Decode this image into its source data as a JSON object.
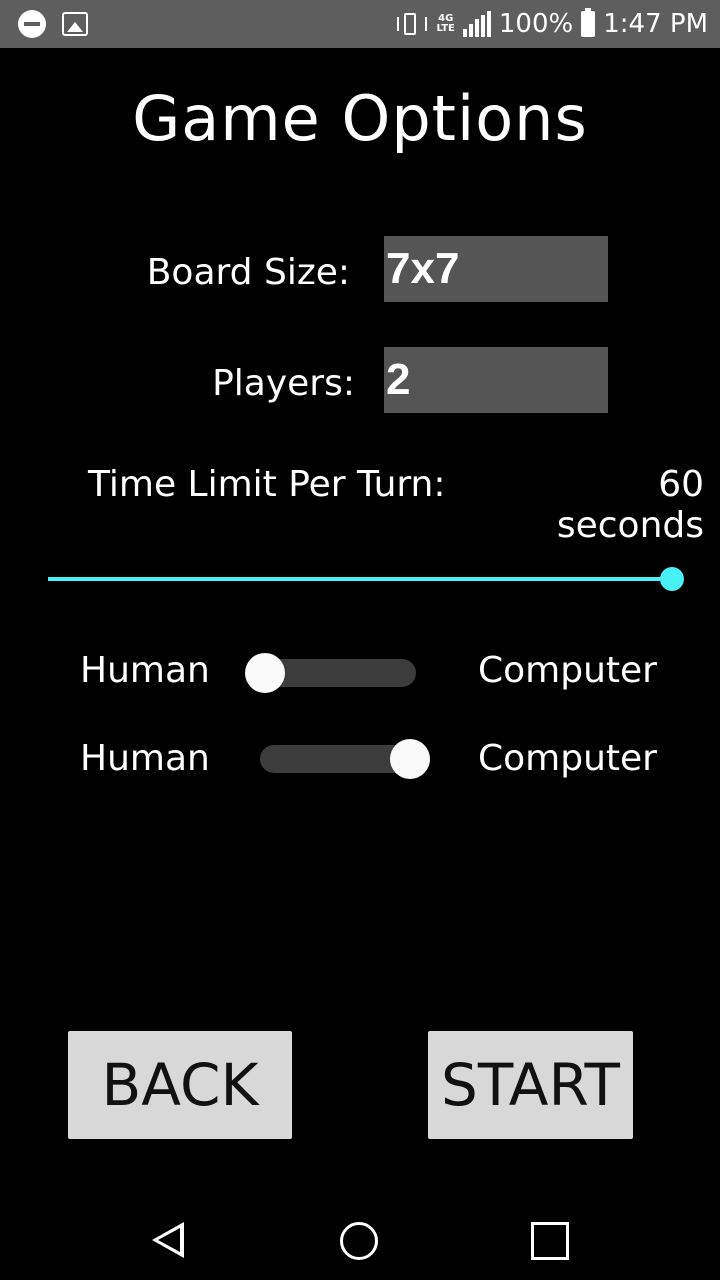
{
  "status_bar": {
    "battery_percent": "100%",
    "time": "1:47 PM",
    "network_label_top": "4G",
    "network_label_bottom": "LTE",
    "icons": [
      "dnd-icon",
      "image-icon",
      "vibrate-icon",
      "signal-icon",
      "battery-icon"
    ]
  },
  "screen": {
    "title": "Game Options",
    "board_size": {
      "label": "Board Size:",
      "value": "7x7"
    },
    "players": {
      "label": "Players:",
      "value": "2"
    },
    "time_limit": {
      "label": "Time Limit Per Turn:",
      "value_text": "60 seconds",
      "slider_level": 1.0
    },
    "player_toggles": [
      {
        "left_label": "Human",
        "right_label": "Computer",
        "state": "Human"
      },
      {
        "left_label": "Human",
        "right_label": "Computer",
        "state": "Computer"
      }
    ],
    "buttons": {
      "back": "BACK",
      "start": "START"
    }
  },
  "nav_bar": {
    "icons": [
      "back-icon",
      "home-icon",
      "recents-icon"
    ]
  },
  "colors": {
    "accent": "#49f0f5",
    "field_bg": "#555555",
    "button_bg": "#d8d8d8",
    "status_bar_bg": "#5e5e5e"
  }
}
